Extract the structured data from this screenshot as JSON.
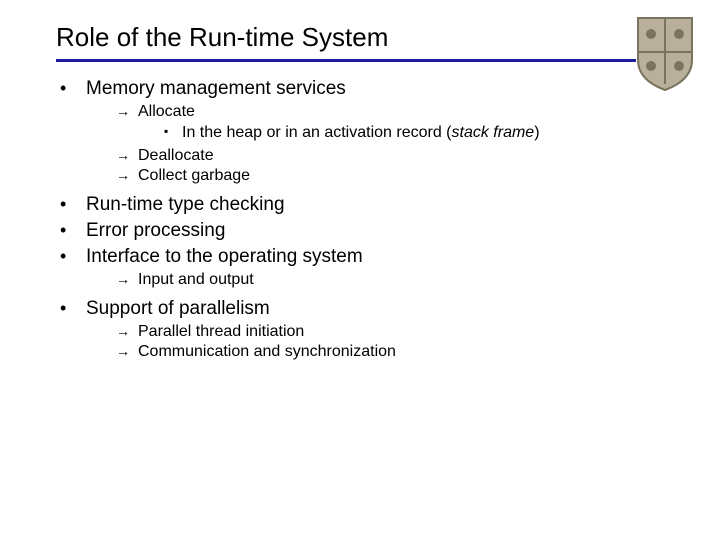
{
  "title": "Role of the Run-time System",
  "bullets": {
    "memory": {
      "label": "Memory management services",
      "allocate": "Allocate",
      "allocate_sub_prefix": "In the heap or in an activation record (",
      "allocate_sub_italic": "stack frame",
      "allocate_sub_suffix": ")",
      "deallocate": "Deallocate",
      "collect": "Collect garbage"
    },
    "typecheck": "Run-time type checking",
    "error": "Error processing",
    "os": {
      "label": "Interface to the operating system",
      "io": "Input and output"
    },
    "parallel": {
      "label": "Support of parallelism",
      "init": "Parallel thread initiation",
      "comm": "Communication and synchronization"
    }
  }
}
